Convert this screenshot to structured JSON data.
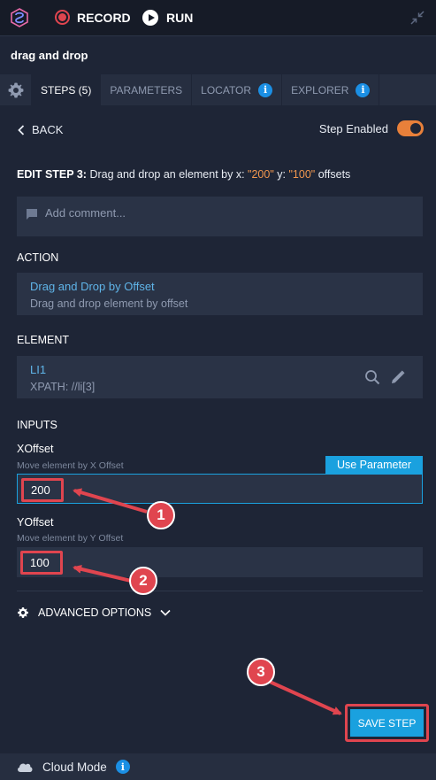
{
  "topbar": {
    "record_label": "RECORD",
    "run_label": "RUN"
  },
  "title": "drag and drop",
  "tabs": [
    {
      "label": "STEPS (5)"
    },
    {
      "label": "PARAMETERS"
    },
    {
      "label": "LOCATOR",
      "info": "i"
    },
    {
      "label": "EXPLORER",
      "info": "i"
    }
  ],
  "nav": {
    "back_label": "BACK",
    "step_enabled_label": "Step Enabled",
    "step_enabled": true
  },
  "edit": {
    "prefix": "EDIT STEP 3:",
    "text1": "Drag and drop an element by x:",
    "x_value": "\"200\"",
    "mid": "y:",
    "y_value": "\"100\"",
    "suffix": "offsets"
  },
  "comment_placeholder": "Add comment...",
  "action": {
    "heading": "ACTION",
    "name": "Drag and Drop by Offset",
    "description": "Drag and drop element by offset"
  },
  "element": {
    "heading": "ELEMENT",
    "name": "LI1",
    "locator": "XPATH: //li[3]"
  },
  "inputs": {
    "heading": "INPUTS",
    "use_parameter_label": "Use Parameter",
    "xoffset": {
      "label": "XOffset",
      "hint": "Move element by X Offset",
      "value": "200"
    },
    "yoffset": {
      "label": "YOffset",
      "hint": "Move element by Y Offset",
      "value": "100"
    }
  },
  "advanced_label": "ADVANCED OPTIONS",
  "badges": [
    "1",
    "2",
    "3"
  ],
  "save_label": "SAVE STEP",
  "footer": {
    "mode_label": "Cloud Mode",
    "info": "i"
  },
  "colors": {
    "accent": "#1aa1df",
    "highlight": "#e0454f",
    "toggle_on": "#e8803a",
    "link": "#5fb4e8"
  }
}
